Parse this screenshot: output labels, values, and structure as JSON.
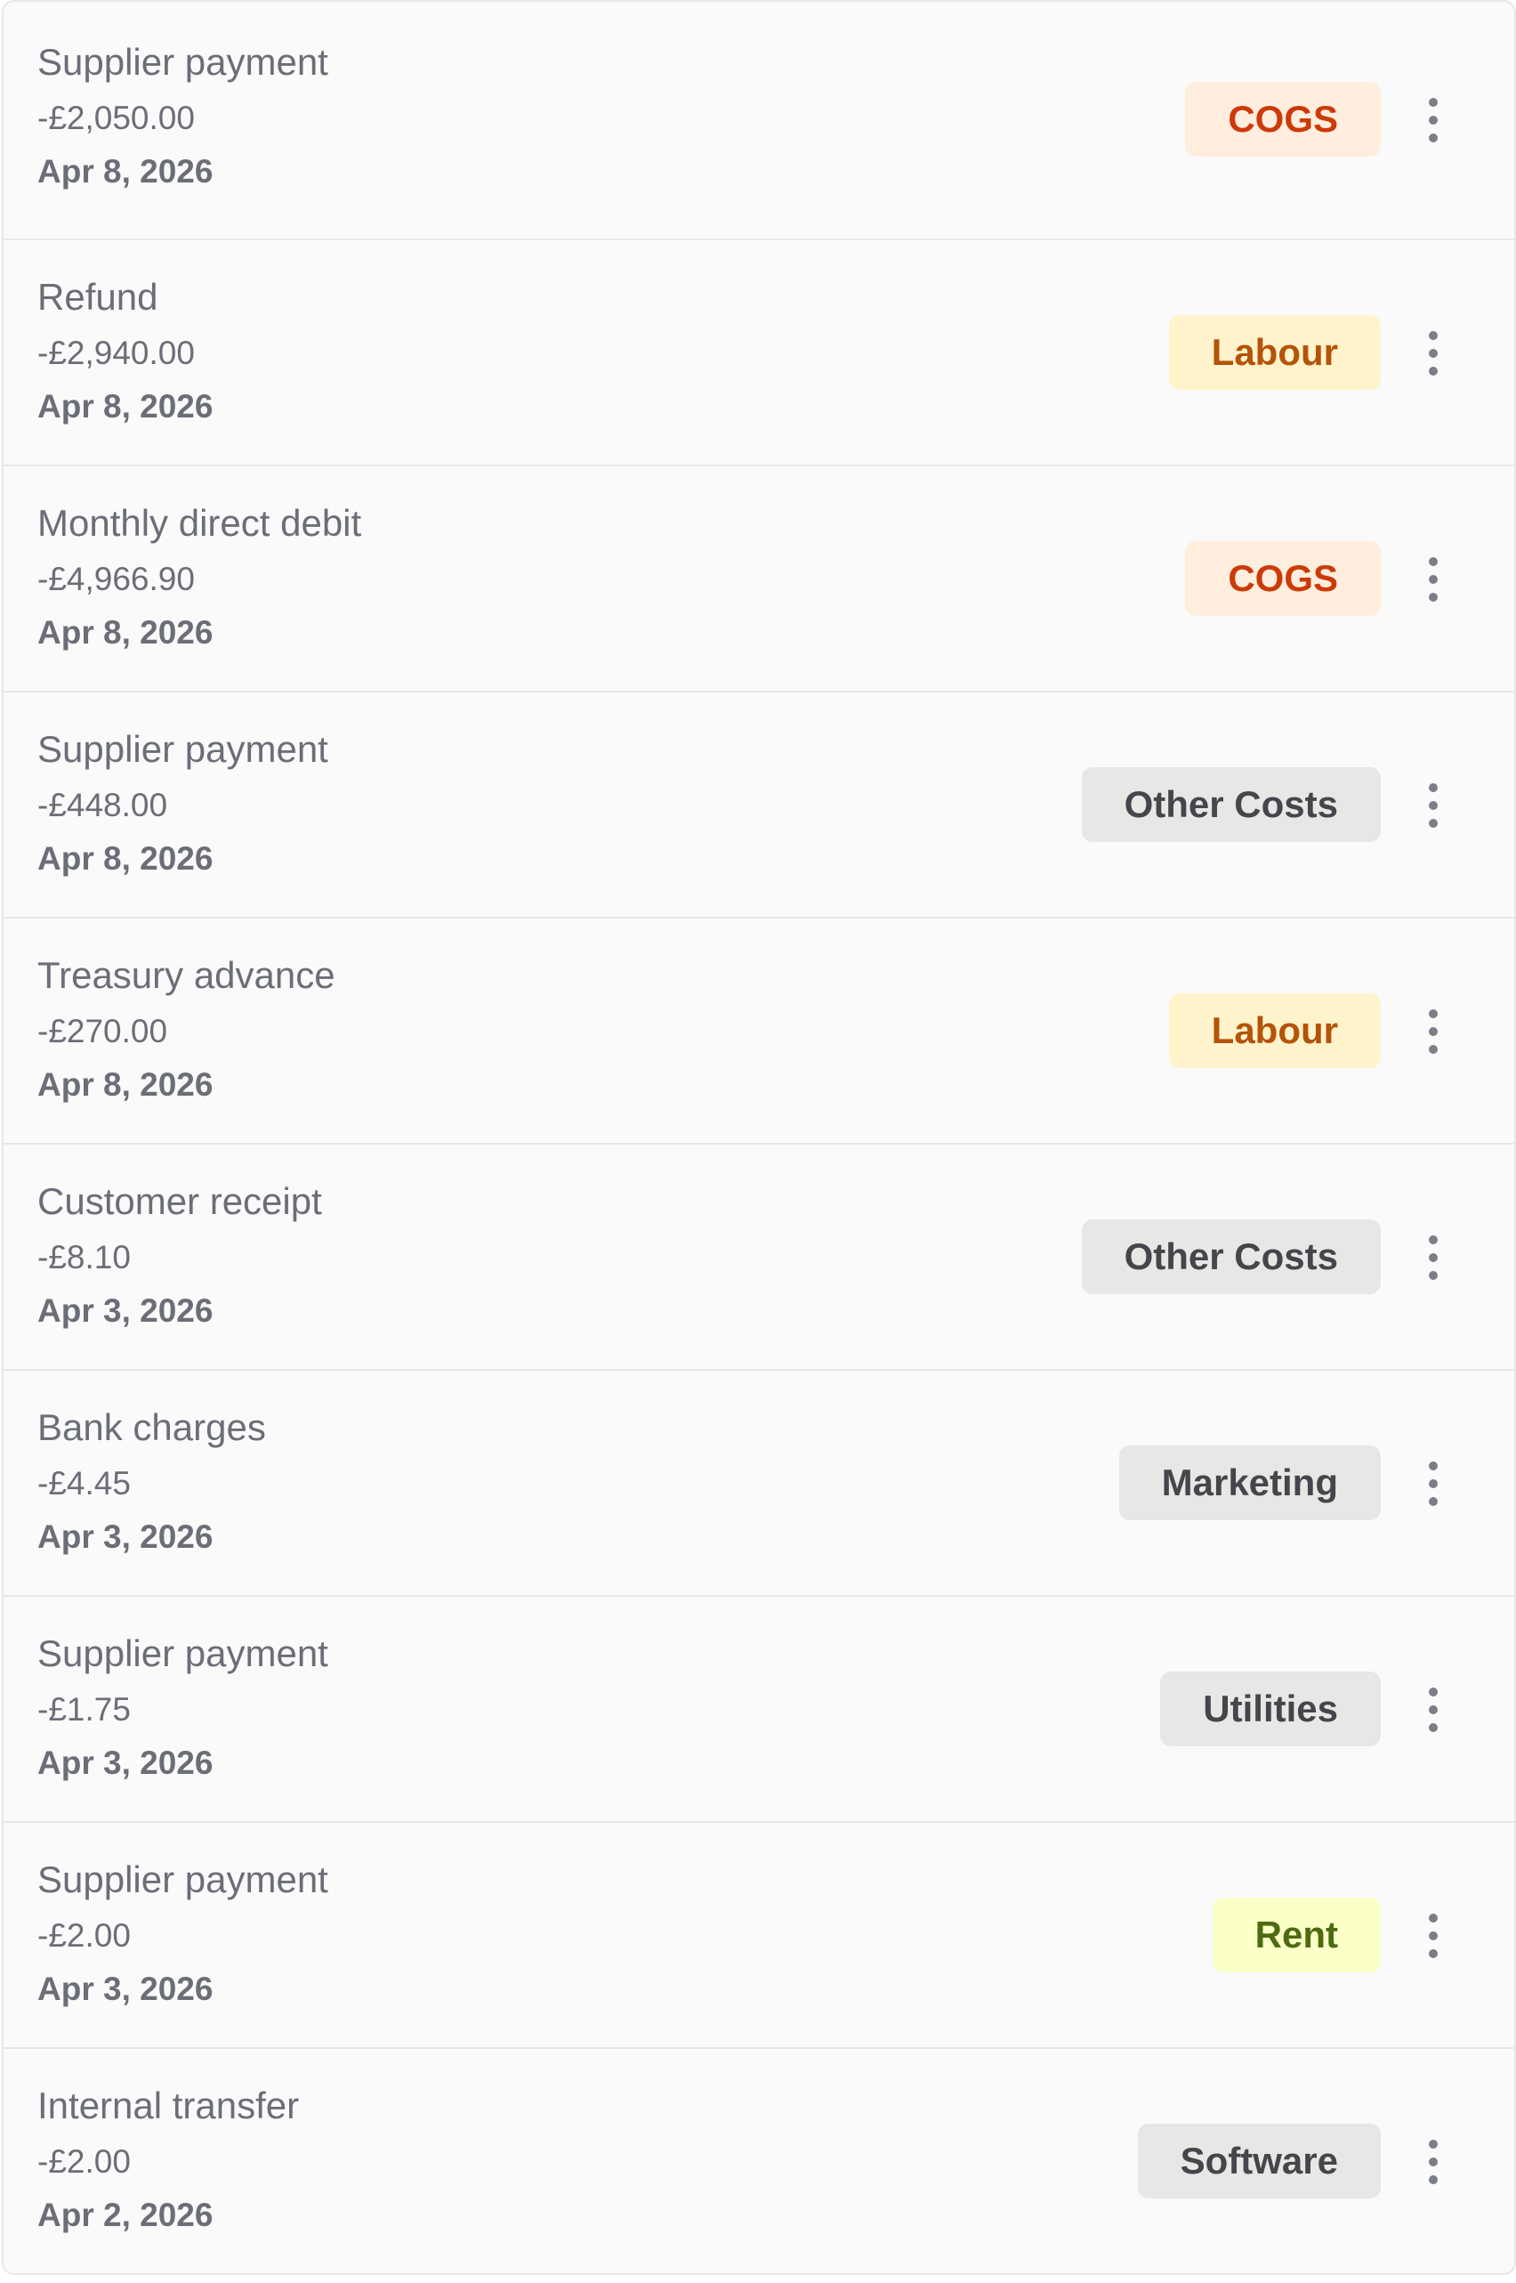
{
  "transactions": [
    {
      "title": "Supplier payment",
      "amount": "-£2,050.00",
      "date": "Apr 8, 2026",
      "category": "COGS",
      "category_style": "cogs"
    },
    {
      "title": "Refund",
      "amount": "-£2,940.00",
      "date": "Apr 8, 2026",
      "category": "Labour",
      "category_style": "labour"
    },
    {
      "title": "Monthly direct debit",
      "amount": "-£4,966.90",
      "date": "Apr 8, 2026",
      "category": "COGS",
      "category_style": "cogs"
    },
    {
      "title": "Supplier payment",
      "amount": "-£448.00",
      "date": "Apr 8, 2026",
      "category": "Other Costs",
      "category_style": "grey"
    },
    {
      "title": "Treasury advance",
      "amount": "-£270.00",
      "date": "Apr 8, 2026",
      "category": "Labour",
      "category_style": "labour"
    },
    {
      "title": "Customer receipt",
      "amount": "-£8.10",
      "date": "Apr 3, 2026",
      "category": "Other Costs",
      "category_style": "grey"
    },
    {
      "title": "Bank charges",
      "amount": "-£4.45",
      "date": "Apr 3, 2026",
      "category": "Marketing",
      "category_style": "grey"
    },
    {
      "title": "Supplier payment",
      "amount": "-£1.75",
      "date": "Apr 3, 2026",
      "category": "Utilities",
      "category_style": "grey"
    },
    {
      "title": "Supplier payment",
      "amount": "-£2.00",
      "date": "Apr 3, 2026",
      "category": "Rent",
      "category_style": "rent"
    },
    {
      "title": "Internal transfer",
      "amount": "-£2.00",
      "date": "Apr 2, 2026",
      "category": "Software",
      "category_style": "grey"
    }
  ],
  "colors": {
    "cogs_bg": "#ffeedd",
    "cogs_text": "#cc3a0a",
    "labour_bg": "#fff3cc",
    "labour_text": "#b45309",
    "grey_bg": "#e7e7e6",
    "grey_text": "#44464b",
    "rent_bg": "#faffc8",
    "rent_text": "#4d6b0f"
  },
  "icons": {
    "row_menu": "more-vertical-icon"
  }
}
